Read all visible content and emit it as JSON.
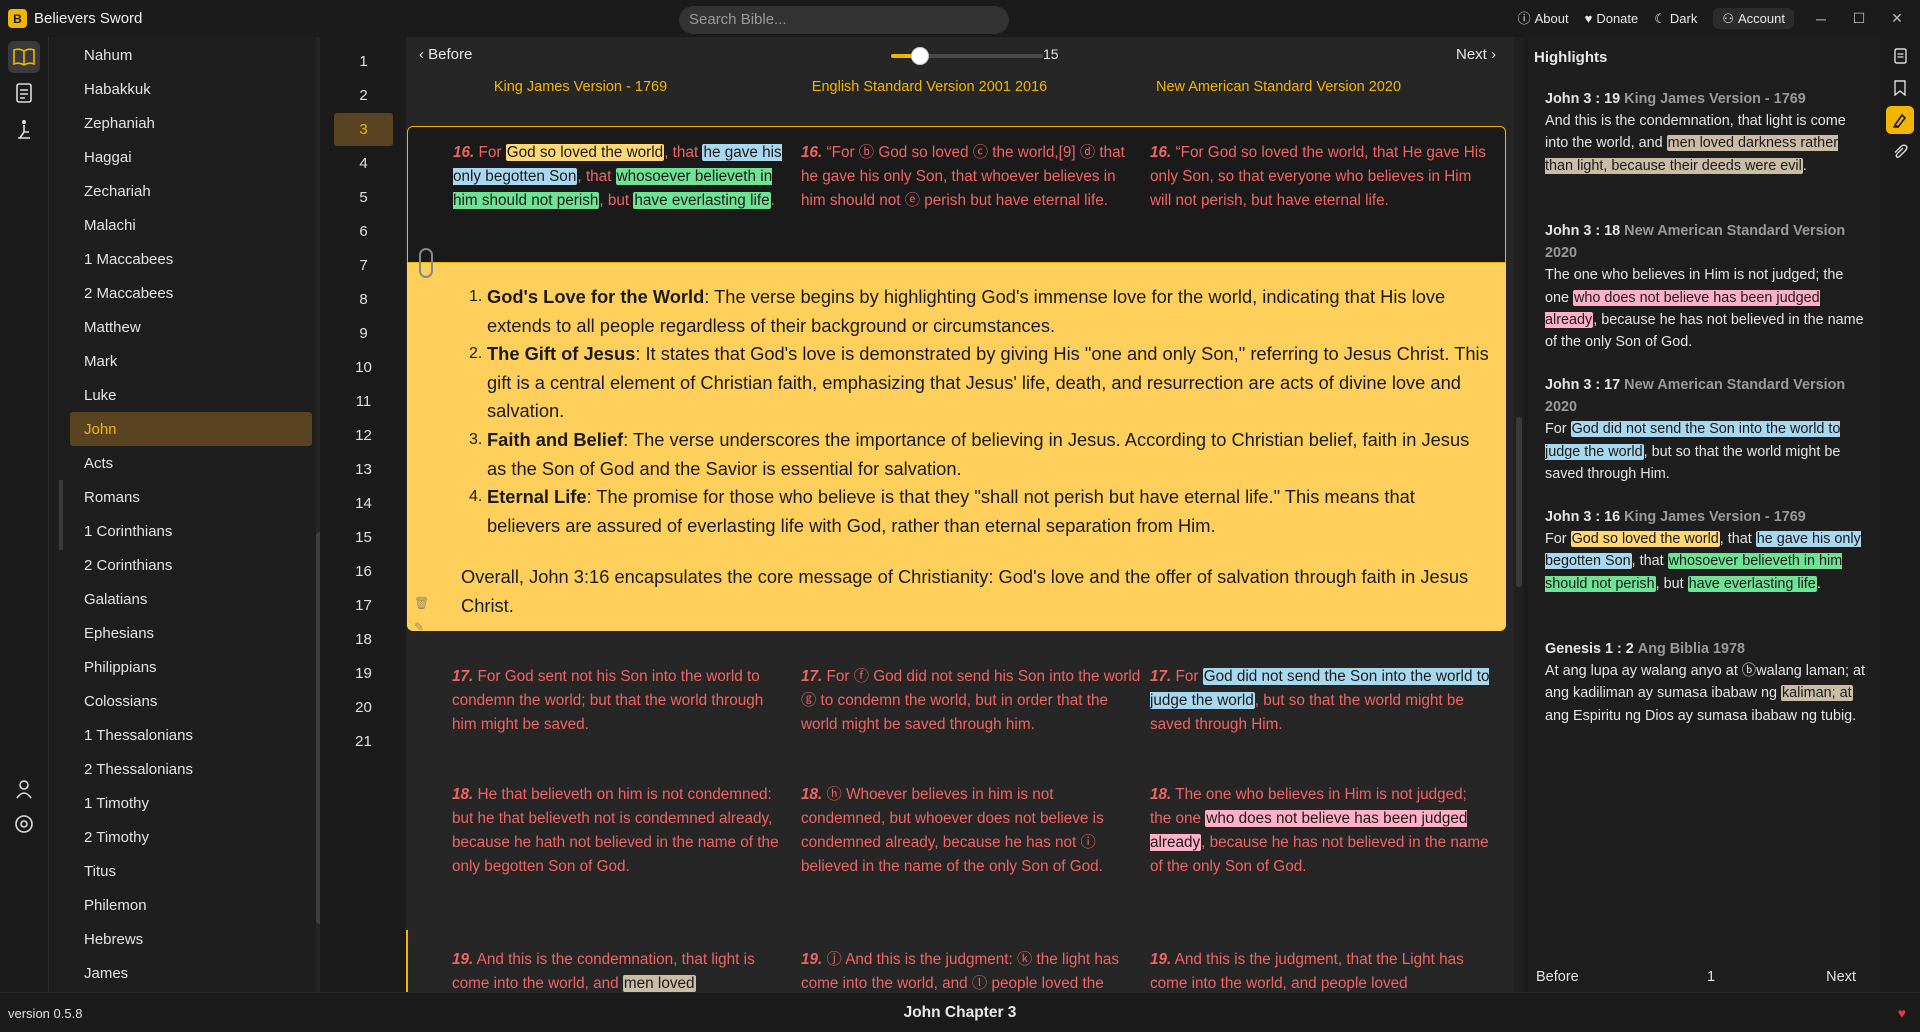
{
  "app": {
    "title": "Believers Sword",
    "logo_letter": "B"
  },
  "titlebar": {
    "search_placeholder": "Search Bible...",
    "about": "About",
    "donate": "Donate",
    "theme": "Dark",
    "account": "Account",
    "win_min": "─",
    "win_max": "☐",
    "win_close": "✕"
  },
  "rail": {
    "icons": [
      "bible-icon",
      "notes-icon",
      "prayer-icon"
    ],
    "bottom_icons": [
      "profile-icon",
      "settings-icon"
    ]
  },
  "books": [
    "Nahum",
    "Habakkuk",
    "Zephaniah",
    "Haggai",
    "Zechariah",
    "Malachi",
    "1 Maccabees",
    "2 Maccabees",
    "Matthew",
    "Mark",
    "Luke",
    "John",
    "Acts",
    "Romans",
    "1 Corinthians",
    "2 Corinthians",
    "Galatians",
    "Ephesians",
    "Philippians",
    "Colossians",
    "1 Thessalonians",
    "2 Thessalonians",
    "1 Timothy",
    "2 Timothy",
    "Titus",
    "Philemon",
    "Hebrews",
    "James"
  ],
  "active_book": "John",
  "chapters": [
    "1",
    "2",
    "3",
    "4",
    "5",
    "6",
    "7",
    "8",
    "9",
    "10",
    "11",
    "12",
    "13",
    "14",
    "15",
    "16",
    "17",
    "18",
    "19",
    "20",
    "21"
  ],
  "active_chapter": "3",
  "nav": {
    "before": "Before",
    "next": "Next",
    "font_size": "15",
    "font_size_fraction": 0.19
  },
  "versions": [
    "King James Version - 1769",
    "English Standard Version 2001 2016",
    "New American Standard Version 2020"
  ],
  "verses": {
    "v16": {
      "kjv": {
        "num": "16.",
        "p1": "For ",
        "h1": "God so loved the world",
        "p2": ", that ",
        "h2": "he gave his only begotten Son",
        "p3": ", that ",
        "h3": "whosoever believeth in him should not perish",
        "p4": ", but ",
        "h4": "have everlasting life",
        "p5": "."
      },
      "esv": {
        "num": "16.",
        "text": "“For ⓑ God so loved ⓒ the world,[9] ⓓ that he gave his only Son, that whoever believes in him should not ⓔ perish but have eternal life."
      },
      "nasb": {
        "num": "16.",
        "text": "“For God so loved the world, that He gave His only Son, so that everyone who believes in Him will not perish, but have eternal life."
      }
    },
    "v17": {
      "kjv": {
        "num": "17.",
        "text": "For God sent not his Son into the world to condemn the world; but that the world through him might be saved."
      },
      "esv": {
        "num": "17.",
        "text": "For ⓕ God did not send his Son into the world ⓖ to condemn the world, but in order that the world might be saved through him."
      },
      "nasb": {
        "num": "17.",
        "p1": "For ",
        "h1": "God did not send the Son into the world to judge the world",
        "p2": ", but so that the world might be saved through Him."
      }
    },
    "v18": {
      "kjv": {
        "num": "18.",
        "text": "He that believeth on him is not condemned: but he that believeth not is condemned already, because he hath not believed in the name of the only begotten Son of God."
      },
      "esv": {
        "num": "18.",
        "text": "ⓗ Whoever believes in him is not condemned, but whoever does not believe is condemned already, because he has not ⓘ believed in the name of the only Son of God."
      },
      "nasb": {
        "num": "18.",
        "p1": "The one who believes in Him is not judged; the one ",
        "h1": "who does not believe has been judged already",
        "p2": ", because he has not believed in the name of the only Son of God."
      }
    },
    "v19": {
      "kjv": {
        "num": "19.",
        "p1": "And this is the condemnation, that light is come into the world, and ",
        "h1": "men loved"
      },
      "esv": {
        "num": "19.",
        "text": "ⓙ And this is the judgment: ⓚ the light has come into the world, and ⓛ people loved the"
      },
      "nasb": {
        "num": "19.",
        "text": "And this is the judgment, that the Light has come into the world, and people loved"
      }
    }
  },
  "note": {
    "items": [
      {
        "n": "1.",
        "title": "God's Love for the World",
        "text": ": The verse begins by highlighting God's immense love for the world, indicating that His love extends to all people regardless of their background or circumstances."
      },
      {
        "n": "2.",
        "title": "The Gift of Jesus",
        "text": ": It states that God's love is demonstrated by giving His \"one and only Son,\" referring to Jesus Christ. This gift is a central element of Christian faith, emphasizing that Jesus' life, death, and resurrection are acts of divine love and salvation."
      },
      {
        "n": "3.",
        "title": "Faith and Belief",
        "text": ": The verse underscores the importance of believing in Jesus. According to Christian belief, faith in Jesus as the Son of God and the Savior is essential for salvation."
      },
      {
        "n": "4.",
        "title": "Eternal Life",
        "text": ": The promise for those who believe is that they \"shall not perish but have eternal life.\" This means that believers are assured of everlasting life with God, rather than eternal separation from Him."
      }
    ],
    "summary": "Overall, John 3:16 encapsulates the core message of Christianity: God's love and the offer of salvation through faith in Jesus Christ."
  },
  "highlights": {
    "title": "Highlights",
    "items": [
      {
        "ref": "John 3 : 19",
        "version": "King James Version - 1769",
        "p1": "And this is the condemnation, that light is come into the world, and ",
        "h1": "men loved darkness rather than light, because their deeds were evil",
        "p2": "."
      },
      {
        "ref": "John 3 : 18",
        "version": "New American Standard Version 2020",
        "p1": "The one who believes in Him is not judged; the one ",
        "h1": "who does not believe has been judged already",
        "p2": ", because he has not believed in the name of the only Son of God."
      },
      {
        "ref": "John 3 : 17",
        "version": "New American Standard Version 2020",
        "p1": "For ",
        "h1": "God did not send the Son into the world to judge the world",
        "p2": ", but so that the world might be saved through Him."
      },
      {
        "ref": "John 3 : 16",
        "version": "King James Version - 1769",
        "p1": "For ",
        "h1": "God so loved the world",
        "p2": ", that ",
        "h2": "he gave his only begotten Son",
        "p3": ", that ",
        "h3": "whosoever believeth in him should not perish",
        "p4": ", but ",
        "h4": "have everlasting life",
        "p5": "."
      },
      {
        "ref": "Genesis 1 : 2",
        "version": "Ang Biblia 1978",
        "p1": "At ang lupa ay walang anyo at ⓑwalang laman; at ang kadiliman ay sumasa ibabaw ng ",
        "h1": "kaliman; at",
        "p2": " ang Espiritu ng Dios ay sumasa ibabaw ng tubig."
      }
    ],
    "before": "Before",
    "page": "1",
    "next": "Next"
  },
  "status": {
    "version": "version 0.5.8",
    "chapter_title": "John Chapter 3",
    "heart": "♥"
  },
  "colors": {
    "accent": "#f2b600",
    "verse_text": "#f06464",
    "note_bg": "#ffcf5c"
  }
}
